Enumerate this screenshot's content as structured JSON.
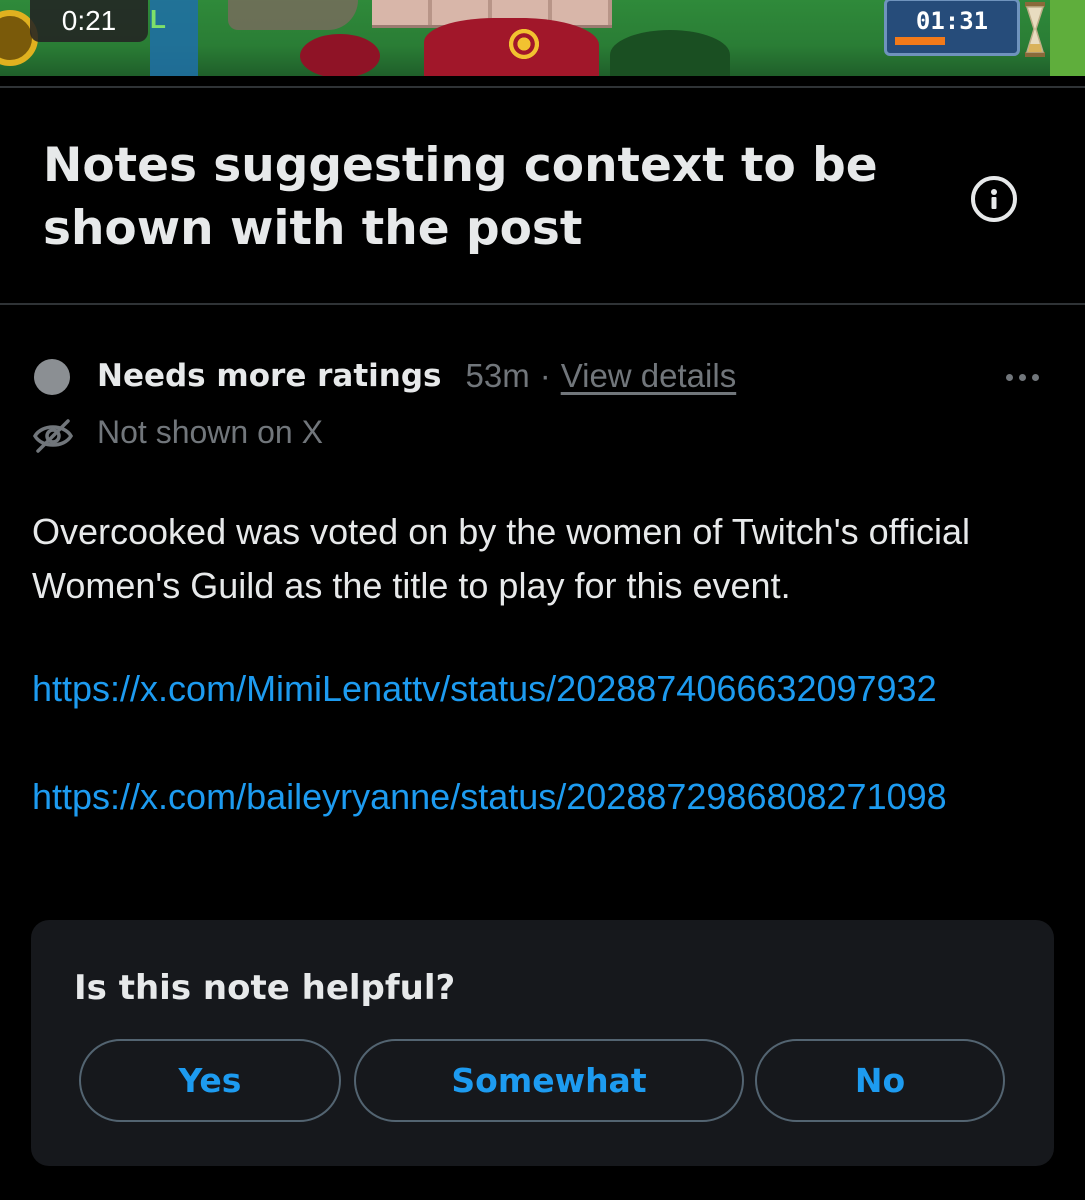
{
  "video": {
    "elapsed": "0:21",
    "game_timer": "01:31",
    "game_badge_letter": "L"
  },
  "header": {
    "title": "Notes suggesting context to be shown with the post",
    "info_icon": "info-circle-icon"
  },
  "note": {
    "status": "Needs more ratings",
    "time_ago": "53m",
    "separator": "·",
    "view_details": "View details",
    "visibility": "Not shown on X",
    "body": "Overcooked was voted on by the women of Twitch's official Women's Guild as the title to play for this event.",
    "links": [
      "https://x.com/MimiLenattv/status/2028874066632097932",
      "https://x.com/baileyryanne/status/2028872986808271098"
    ]
  },
  "rating": {
    "question": "Is this note helpful?",
    "options": [
      "Yes",
      "Somewhat",
      "No"
    ]
  },
  "colors": {
    "background": "#000000",
    "card": "#16181c",
    "accent": "#1d9bf0",
    "muted": "#71767b",
    "text": "#e7e9ea"
  }
}
